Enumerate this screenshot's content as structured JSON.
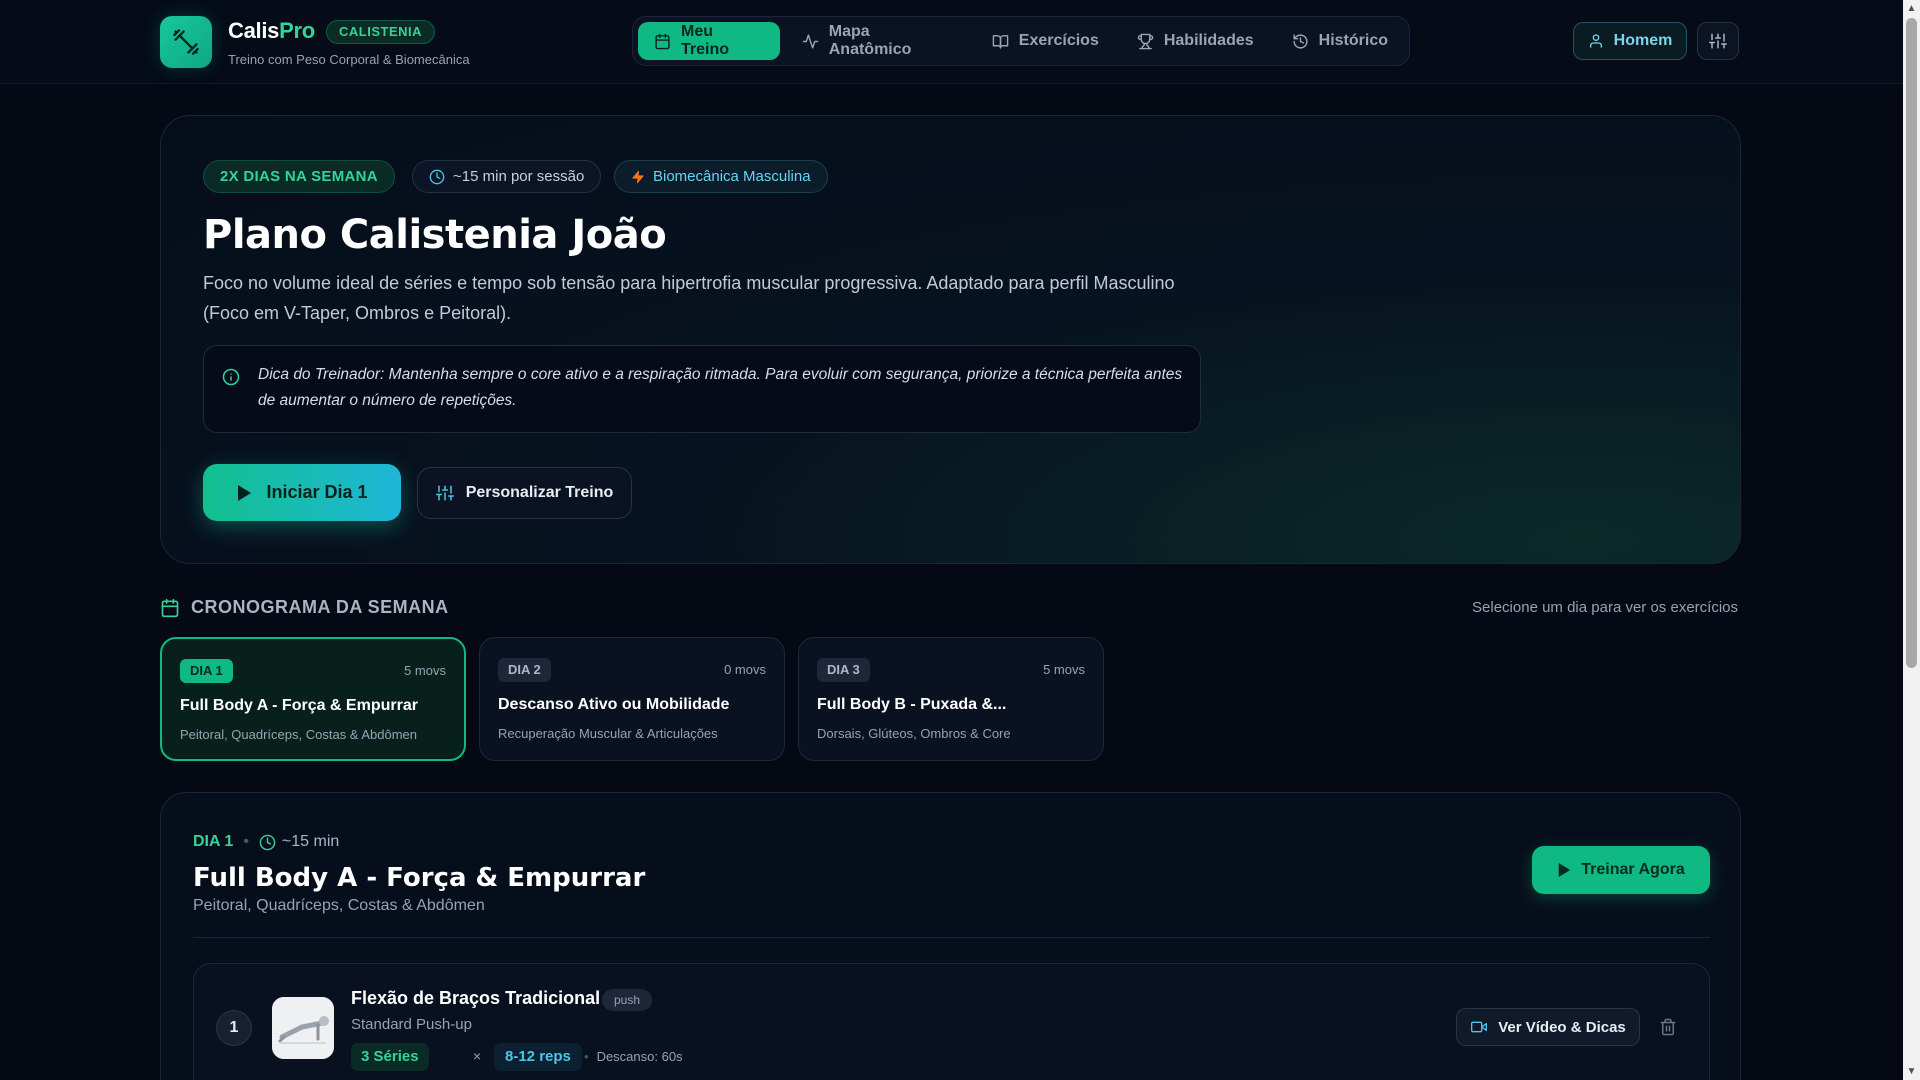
{
  "colors": {
    "accent": "#10b981",
    "accent_cyan": "#22c3d8",
    "background": "#040914"
  },
  "header": {
    "brand_part1": "Calis",
    "brand_part2": "Pro",
    "brand_badge": "CALISTENIA",
    "subtitle": "Treino com Peso Corporal & Biomecânica",
    "gender_label": "Homem"
  },
  "nav": {
    "items": [
      {
        "label": "Meu Treino",
        "icon": "calendar-icon",
        "active": true
      },
      {
        "label": "Mapa Anatômico",
        "icon": "activity-icon",
        "active": false
      },
      {
        "label": "Exercícios",
        "icon": "book-icon",
        "active": false
      },
      {
        "label": "Habilidades",
        "icon": "trophy-icon",
        "active": false
      },
      {
        "label": "Histórico",
        "icon": "history-icon",
        "active": false
      }
    ]
  },
  "hero": {
    "chip_days": "2X DIAS NA SEMANA",
    "chip_time": "~15 min por sessão",
    "chip_bio": "Biomecânica Masculina",
    "title": "Plano Calistenia João",
    "description": "Foco no volume ideal de séries e tempo sob tensão para hipertrofia muscular progressiva. Adaptado para perfil Masculino (Foco em V-Taper, Ombros e Peitoral).",
    "tip": "Dica do Treinador: Mantenha sempre o core ativo e a respiração ritmada. Para evoluir com segurança, priorize a técnica perfeita antes de aumentar o número de repetições.",
    "start_button": "Iniciar Dia 1",
    "customize_button": "Personalizar Treino"
  },
  "schedule": {
    "title": "CRONOGRAMA DA SEMANA",
    "hint": "Selecione um dia para ver os exercícios",
    "days": [
      {
        "tag": "DIA 1",
        "movs": "5 movs",
        "name": "Full Body A - Força & Empurrar",
        "muscles": "Peitoral, Quadríceps, Costas & Abdômen",
        "active": true
      },
      {
        "tag": "DIA 2",
        "movs": "0 movs",
        "name": "Descanso Ativo ou Mobilidade",
        "muscles": "Recuperação Muscular & Articulações",
        "active": false
      },
      {
        "tag": "DIA 3",
        "movs": "5 movs",
        "name": "Full Body B - Puxada &...",
        "muscles": "Dorsais, Glúteos, Ombros & Core",
        "active": false
      }
    ]
  },
  "detail": {
    "day": "DIA 1",
    "duration": "~15 min",
    "title": "Full Body A - Força & Empurrar",
    "muscles": "Peitoral, Quadríceps, Costas & Abdômen",
    "train_button": "Treinar Agora",
    "exercises": [
      {
        "number": "1",
        "name": "Flexão de Braços Tradicional",
        "tag": "push",
        "english": "Standard Push-up",
        "sets": "3 Séries",
        "times": "×",
        "reps": "8-12 reps",
        "rest": "Descanso: 60s",
        "video_button": "Ver Vídeo & Dicas"
      }
    ]
  }
}
